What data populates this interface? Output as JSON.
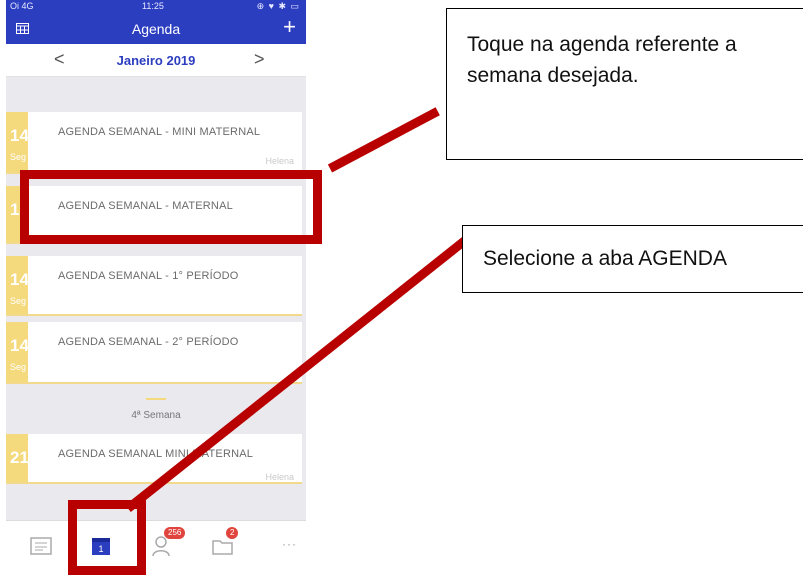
{
  "status_bar": {
    "carrier": "Oi 4G",
    "time": "11:25",
    "icons": "⊕ ♥ ✱ ▭"
  },
  "header": {
    "title": "Agenda",
    "add_label": "+"
  },
  "month_nav": {
    "prev": "<",
    "month": "Janeiro 2019",
    "next": ">"
  },
  "agenda_items": [
    {
      "day": "14",
      "weekday": "Seg",
      "title": "AGENDA SEMANAL - MINI MATERNAL",
      "author": "Helena"
    },
    {
      "day": "14",
      "weekday": "",
      "title": "AGENDA SEMANAL - MATERNAL",
      "author": ""
    },
    {
      "day": "14",
      "weekday": "Seg",
      "title": "AGENDA SEMANAL - 1° PERÍODO",
      "author": ""
    },
    {
      "day": "14",
      "weekday": "Seg",
      "title": "AGENDA SEMANAL - 2° PERÍODO",
      "author": ""
    },
    {
      "day": "21",
      "weekday": "",
      "title": "AGENDA SEMANAL MINI MATERNAL",
      "author": "Helena"
    }
  ],
  "week_separator": "4ª Semana",
  "tab_bar": {
    "tabs": [
      {
        "icon": "news-icon"
      },
      {
        "icon": "calendar-icon",
        "label": "1",
        "active": true
      },
      {
        "icon": "contacts-icon",
        "badge": "256"
      },
      {
        "icon": "folder-icon",
        "badge": "2"
      },
      {
        "icon": "more-icon",
        "label": "···"
      }
    ]
  },
  "annotations": {
    "callout1": "Toque na agenda referente a semana desejada.",
    "callout2": "Selecione a aba AGENDA"
  },
  "colors": {
    "header_blue": "#2c3ec0",
    "day_yellow": "#f5d97d",
    "highlight_red": "#b80000",
    "badge_red": "#e0453d"
  }
}
